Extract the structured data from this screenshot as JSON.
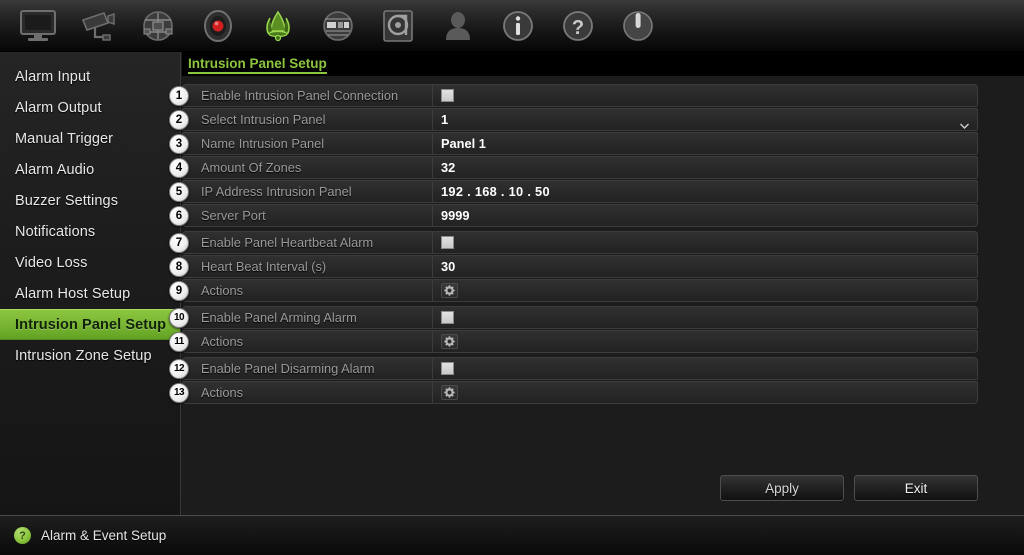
{
  "toolbar": {
    "items": [
      {
        "name": "monitor-icon",
        "title": "Display"
      },
      {
        "name": "camera-icon",
        "title": "Camera"
      },
      {
        "name": "network-icon",
        "title": "Network"
      },
      {
        "name": "record-icon",
        "title": "Record"
      },
      {
        "name": "alarm-event-icon",
        "title": "Alarm & Event Setup"
      },
      {
        "name": "device-icon",
        "title": "Device Management"
      },
      {
        "name": "hdd-icon",
        "title": "HDD"
      },
      {
        "name": "user-icon",
        "title": "User"
      },
      {
        "name": "info-icon",
        "title": "System Information"
      },
      {
        "name": "help-icon",
        "title": "Help"
      },
      {
        "name": "power-icon",
        "title": "Shutdown"
      }
    ]
  },
  "sidebar": {
    "items": [
      {
        "label": "Alarm Input",
        "active": false
      },
      {
        "label": "Alarm Output",
        "active": false
      },
      {
        "label": "Manual Trigger",
        "active": false
      },
      {
        "label": "Alarm Audio",
        "active": false
      },
      {
        "label": "Buzzer Settings",
        "active": false
      },
      {
        "label": "Notifications",
        "active": false
      },
      {
        "label": "Video Loss",
        "active": false
      },
      {
        "label": "Alarm Host Setup",
        "active": false
      },
      {
        "label": "Intrusion Panel Setup",
        "active": true
      },
      {
        "label": "Intrusion Zone Setup",
        "active": false
      }
    ]
  },
  "main": {
    "title": "Intrusion Panel Setup",
    "groups": [
      {
        "rows": [
          {
            "num": "1",
            "label": "Enable Intrusion Panel Connection",
            "type": "checkbox",
            "value": "",
            "checked": false
          },
          {
            "num": "2",
            "label": "Select Intrusion Panel",
            "type": "dropdown",
            "value": "1"
          },
          {
            "num": "3",
            "label": "Name Intrusion Panel",
            "type": "text",
            "value": "Panel 1"
          },
          {
            "num": "4",
            "label": "Amount Of Zones",
            "type": "text",
            "value": "32"
          },
          {
            "num": "5",
            "label": "IP Address Intrusion Panel",
            "type": "ip",
            "value": "192 . 168 . 10    . 50"
          },
          {
            "num": "6",
            "label": "Server Port",
            "type": "text",
            "value": "9999"
          }
        ]
      },
      {
        "rows": [
          {
            "num": "7",
            "label": "Enable Panel Heartbeat Alarm",
            "type": "checkbox",
            "value": "",
            "checked": false
          },
          {
            "num": "8",
            "label": "Heart Beat Interval (s)",
            "type": "text",
            "value": "30"
          },
          {
            "num": "9",
            "label": "Actions",
            "type": "gear",
            "value": ""
          }
        ]
      },
      {
        "rows": [
          {
            "num": "10",
            "label": "Enable Panel Arming Alarm",
            "type": "checkbox",
            "value": "",
            "checked": false
          },
          {
            "num": "11",
            "label": "Actions",
            "type": "gear",
            "value": ""
          }
        ]
      },
      {
        "rows": [
          {
            "num": "12",
            "label": "Enable Panel Disarming Alarm",
            "type": "checkbox",
            "value": "",
            "checked": false
          },
          {
            "num": "13",
            "label": "Actions",
            "type": "gear",
            "value": ""
          }
        ]
      }
    ],
    "buttons": {
      "apply_label": "Apply",
      "exit_label": "Exit"
    }
  },
  "statusbar": {
    "icon": "help-badge-icon",
    "icon_glyph": "?",
    "text": "Alarm & Event Setup"
  },
  "colors": {
    "accent_green": "#8cc63f",
    "panel_bg": "#1c1c1c",
    "row_bg": "#292929",
    "label_text": "#9a9a9a",
    "value_text": "#ffffff"
  }
}
